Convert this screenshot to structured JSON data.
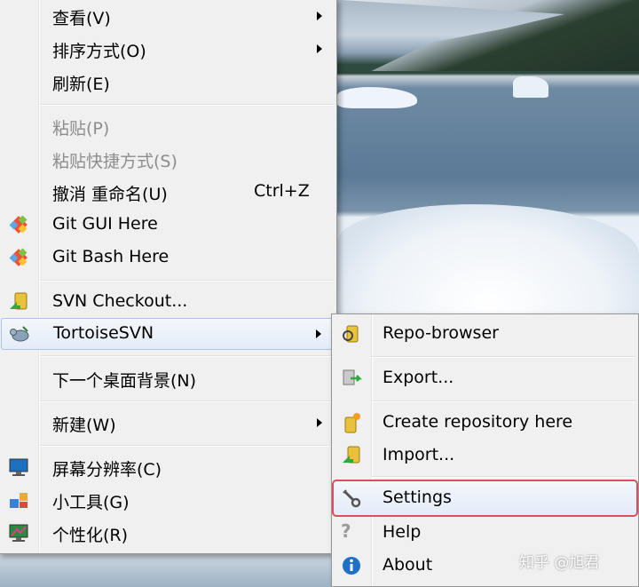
{
  "context_menu": {
    "items": [
      {
        "label": "查看(V)",
        "has_submenu": true
      },
      {
        "label": "排序方式(O)",
        "has_submenu": true
      },
      {
        "label": "刷新(E)"
      },
      {
        "label": "粘贴(P)",
        "disabled": true
      },
      {
        "label": "粘贴快捷方式(S)",
        "disabled": true
      },
      {
        "label": "撤消 重命名(U)",
        "shortcut": "Ctrl+Z"
      },
      {
        "label": "Git GUI Here",
        "icon": "git-icon"
      },
      {
        "label": "Git Bash Here",
        "icon": "git-icon"
      },
      {
        "label": "SVN Checkout...",
        "icon": "svn-checkout-icon"
      },
      {
        "label": "TortoiseSVN",
        "icon": "tortoisesvn-icon",
        "has_submenu": true,
        "active": true
      },
      {
        "label": "下一个桌面背景(N)"
      },
      {
        "label": "新建(W)",
        "has_submenu": true
      },
      {
        "label": "屏幕分辨率(C)",
        "icon": "monitor-icon"
      },
      {
        "label": "小工具(G)",
        "icon": "gadgets-icon"
      },
      {
        "label": "个性化(R)",
        "icon": "personalize-icon"
      }
    ]
  },
  "submenu": {
    "items": [
      {
        "label": "Repo-browser",
        "icon": "repo-browser-icon"
      },
      {
        "label": "Export...",
        "icon": "export-icon"
      },
      {
        "label": "Create repository here",
        "icon": "create-repo-icon"
      },
      {
        "label": "Import...",
        "icon": "import-icon"
      },
      {
        "label": "Settings",
        "icon": "settings-icon",
        "highlighted": true
      },
      {
        "label": "Help",
        "icon": "help-icon"
      },
      {
        "label": "About",
        "icon": "about-icon"
      }
    ]
  },
  "highlight_color": "#e04b60",
  "watermark": "知乎 @旭君"
}
